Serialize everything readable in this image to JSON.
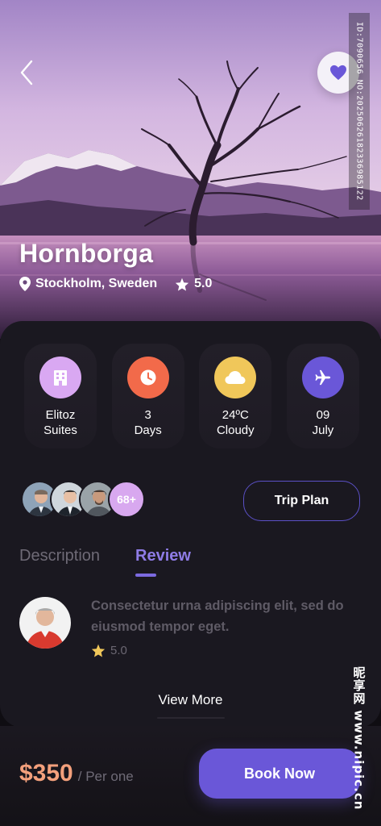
{
  "hero": {
    "title": "Hornborga",
    "location": "Stockholm, Sweden",
    "rating": "5.0",
    "favorite_icon": "heart-icon",
    "back_icon": "chevron-left-icon"
  },
  "info_items": [
    {
      "line1": "Elitoz",
      "line2": "Suites",
      "icon": "hotel-icon",
      "color": "#d9a8f2"
    },
    {
      "line1": "3",
      "line2": "Days",
      "icon": "clock-icon",
      "color": "#f26a4a"
    },
    {
      "line1": "24ºC",
      "line2": "Cloudy",
      "icon": "cloud-icon",
      "color": "#f0c75a"
    },
    {
      "line1": "09",
      "line2": "July",
      "icon": "plane-icon",
      "color": "#6a57d8"
    }
  ],
  "travelers": {
    "more_count": "68+"
  },
  "trip_plan_label": "Trip Plan",
  "tabs": [
    {
      "label": "Description",
      "active": false
    },
    {
      "label": "Review",
      "active": true
    }
  ],
  "review": {
    "text": "Consectetur  urna adipiscing elit, sed do eiusmod tempor eget.",
    "rating": "5.0"
  },
  "view_more_label": "View More",
  "footer": {
    "price": "$350",
    "unit": "/ Per one",
    "book_label": "Book Now"
  },
  "watermark": {
    "id": "ID:7090656 NO:20250626182336985122",
    "site": "昵享网 www.nipic.cn"
  },
  "colors": {
    "accent": "#6a57d8",
    "price": "#f3a07c",
    "card": "#1a1820"
  }
}
